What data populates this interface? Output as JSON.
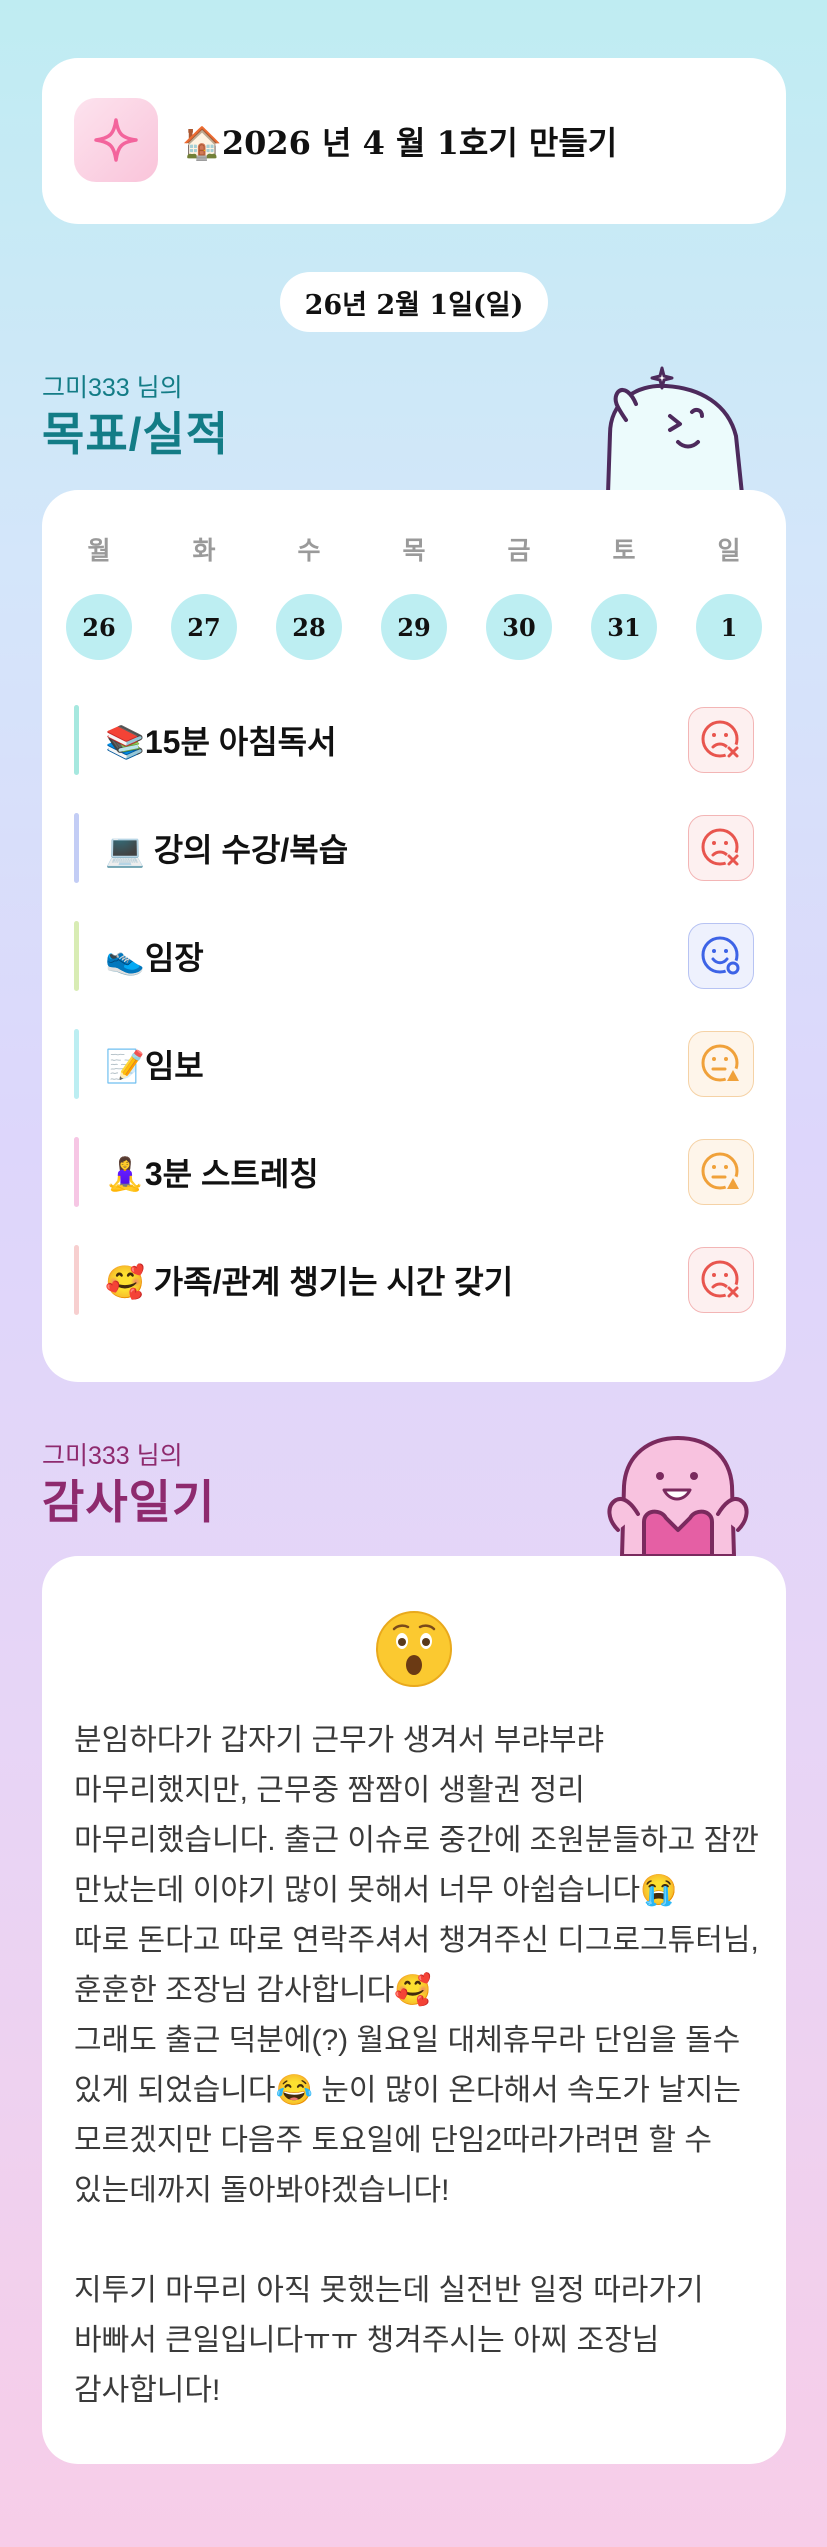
{
  "header": {
    "app_icon": "sparkle-icon",
    "title": "🏠2026 년 4 월 1호기 만들기"
  },
  "date": "26년 2월 1일(일)",
  "goals_section": {
    "user": "그미333 님의",
    "title": "목표/실적",
    "mascot": "ghost-mascot-thinking"
  },
  "week": {
    "days": [
      {
        "name": "월",
        "num": "26"
      },
      {
        "name": "화",
        "num": "27"
      },
      {
        "name": "수",
        "num": "28"
      },
      {
        "name": "목",
        "num": "29"
      },
      {
        "name": "금",
        "num": "30"
      },
      {
        "name": "토",
        "num": "31"
      },
      {
        "name": "일",
        "num": "1"
      }
    ]
  },
  "goals": [
    {
      "label": "📚15분 아침독서",
      "bar_color": "#a6e8df",
      "status": "failed",
      "status_icon": "sad-face-x-icon"
    },
    {
      "label": "💻 강의 수강/복습",
      "bar_color": "#c3cdf5",
      "status": "failed",
      "status_icon": "sad-face-x-icon"
    },
    {
      "label": "👟임장",
      "bar_color": "#d8ecb4",
      "status": "done",
      "status_icon": "smile-face-check-icon"
    },
    {
      "label": "📝임보",
      "bar_color": "#bceef2",
      "status": "partial",
      "status_icon": "neutral-face-triangle-icon"
    },
    {
      "label": "🧘‍♀️3분 스트레칭",
      "bar_color": "#f6c6e4",
      "status": "partial",
      "status_icon": "neutral-face-triangle-icon"
    },
    {
      "label": "🥰 가족/관계 챙기는 시간 갖기",
      "bar_color": "#f7cfcf",
      "status": "failed",
      "status_icon": "sad-face-x-icon"
    }
  ],
  "gratitude_section": {
    "user": "그미333 님의",
    "title": "감사일기",
    "mascot": "pink-mascot-heart",
    "mood_emoji": "😲",
    "text": "분임하다가 갑자기 근무가 생겨서 부랴부랴 마무리했지만, 근무중 짬짬이 생활권 정리 마무리했습니다. 출근 이슈로 중간에 조원분들하고 잠깐 만났는데 이야기 많이 못해서 너무 아쉽습니다😭\n따로 돈다고 따로 연락주셔서 챙겨주신 디그로그튜터님, 훈훈한 조장님 감사합니다🥰\n그래도 출근 덕분에(?) 월요일 대체휴무라 단임을 돌수 있게 되었습니다😂 눈이 많이 온다해서 속도가 날지는 모르겠지만 다음주 토요일에 단임2따라가려면 할 수 있는데까지 돌아봐야겠습니다!\n\n지투기 마무리 아직 못했는데 실전반 일정 따라가기 바빠서 큰일입니다ㅠㅠ 챙겨주시는 아찌 조장님 감사합니다!"
  },
  "colors": {
    "accent_teal": "#137c86",
    "accent_plum": "#8e2a6e",
    "day_circle": "#bdeef2",
    "failed": "#e8554e",
    "done": "#3d63e6",
    "partial": "#f0a13a"
  }
}
